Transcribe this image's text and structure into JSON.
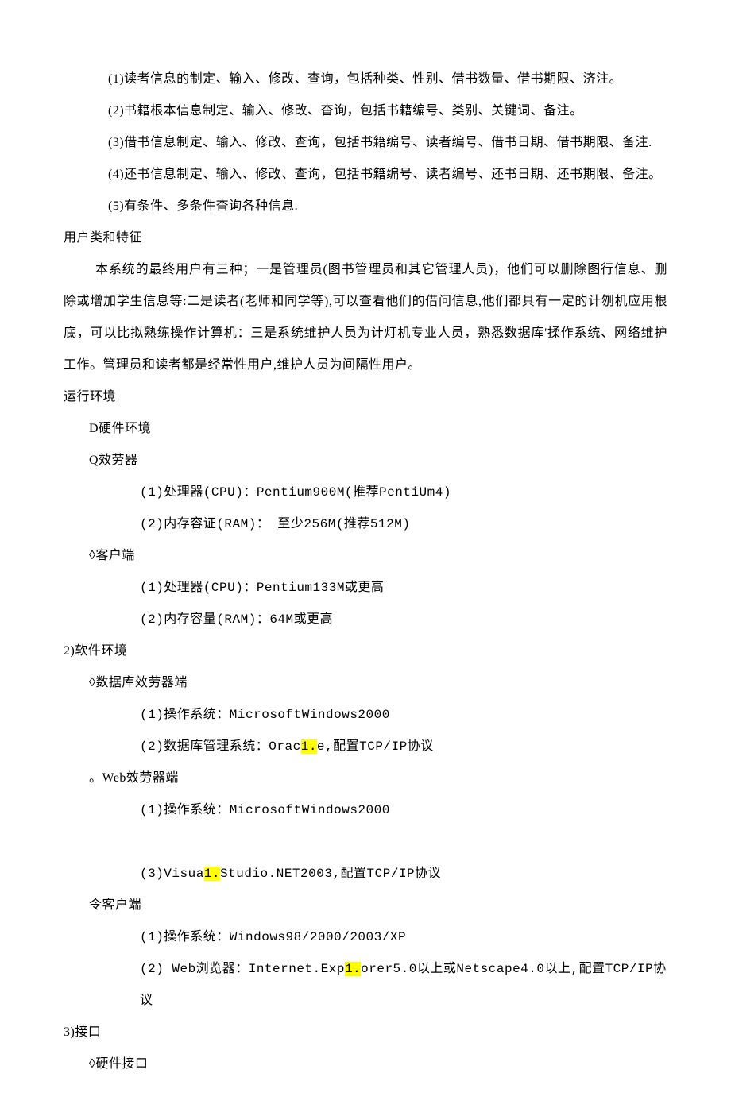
{
  "lines": {
    "l1": "(1)读者信息的制定、输入、修改、查询，包括种类、性别、借书数量、借书期限、济注。",
    "l2": "(2)书籍根本信息制定、输入、修改、杳询，包括书籍编号、类别、关键词、备注。",
    "l3": "(3)借书信息制定、输入、修改、查询，包括书籍编号、读者编号、借书日期、借书期限、备注.",
    "l4": "(4)还书信息制定、输入、修改、查询，包括书籍编号、读者编号、还书日期、还书期限、备注。",
    "l5": "(5)有条件、多条件杳询各种信息.",
    "h_user": "用户类和特征",
    "p_user": "本系统的最终用户有三种；一是管理员(图书管理员和其它管理人员)，他们可以删除图行信息、删除或增加学生信息等:二是读者(老师和同学等),可以查看他们的借问信息,他们都具有一定的计刎机应用根底，可以比拟熟练操作计算机：三是系统维护人员为计灯机专业人员，熟悉数据库'揉作系统、网络维护工作。管理员和读者都是经常性用户,维护人员为间隔性用户。",
    "h_env": "运行环境",
    "hw": "D硬件环境",
    "server_h": "Q效劳器",
    "server_1": "(1)处理器(CPU)：Pentium900M(推荐PentiUm4)",
    "server_2": "(2)内存容证(RAM)： 至少256M(推荐512M)",
    "client_h": "◊客户端",
    "client_1": "(1)处理器(CPU)：Pentium133M或更高",
    "client_2": "(2)内存容量(RAM)：64M或更高",
    "sw_h": "2)软件环境",
    "db_h": "◊数据库效劳器端",
    "db_1": "(1)操作系统：MicrosoftWindows2000",
    "db_2_a": "(2)数据库管理系统：Orac",
    "db_2_b": "1.",
    "db_2_c": "e,配置TCP/IP协议",
    "web_h": "。Web效劳器端",
    "web_1": "(1)操作系统：MicrosoftWindows2000",
    "web_3_a": "(3)Visua",
    "web_3_b": "1.",
    "web_3_c": "Studio.NET2003,配置TCP/IP协议",
    "cli2_h": "令客户端",
    "cli2_1": "(1)操作系统：Windows98/2000/2003/XP",
    "cli2_2_a": "(2) Web浏览器：Internet.Exp",
    "cli2_2_b": "1.",
    "cli2_2_c": "orer5.0以上或Netscape4.0以上,配置TCP/IP协议",
    "if_h": "3)接口",
    "hwif": "◊硬件接口"
  }
}
